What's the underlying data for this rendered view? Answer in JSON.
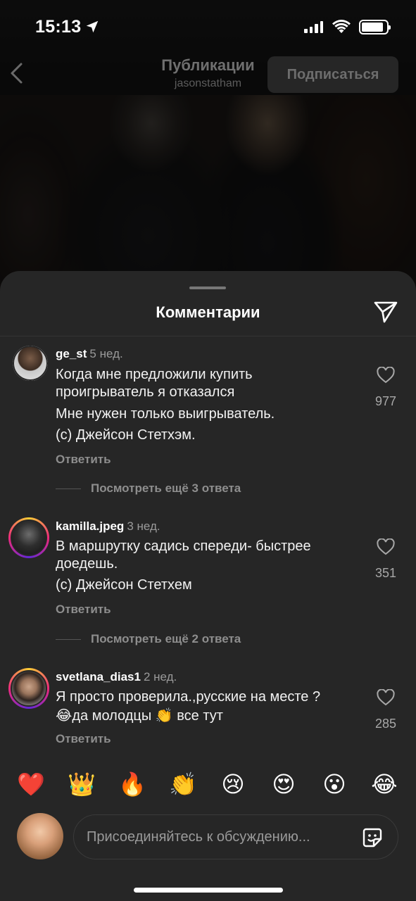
{
  "status_bar": {
    "time": "15:13"
  },
  "nav": {
    "title": "Публикации",
    "subtitle": "jasonstatham",
    "follow_label": "Подписаться"
  },
  "sheet": {
    "title": "Комментарии"
  },
  "comments": [
    {
      "username": "ge_st",
      "ago": "5 нед.",
      "lines": [
        "Когда мне предложили купить",
        "проигрыватель я отказался",
        "Мне нужен только выигрыватель.",
        "(с) Джейсон Стетхэм."
      ],
      "reply": "Ответить",
      "likes": "977",
      "more_replies": "Посмотреть ещё 3 ответа"
    },
    {
      "username": "kamilla.jpeg",
      "ago": "3 нед.",
      "lines": [
        "В маршрутку садись спереди- быстрее",
        "доедешь.",
        "(с) Джейсон Стетхем"
      ],
      "reply": "Ответить",
      "likes": "351",
      "more_replies": "Посмотреть ещё 2 ответа"
    },
    {
      "username": "svetlana_dias1",
      "ago": "2 нед.",
      "lines": [
        "Я просто проверила.,русские на месте ?",
        "😂да молодцы 👏 все тут"
      ],
      "reply": "Ответить",
      "likes": "285"
    }
  ],
  "reactions": [
    "❤️",
    "👑",
    "🔥",
    "👏",
    "😢",
    "😍",
    "😮",
    "😂"
  ],
  "composer": {
    "placeholder": "Присоединяйтесь к обсуждению..."
  },
  "colors": {
    "sheet_bg": "#262626",
    "secondary_text": "#8e8e8e",
    "heart_red": "#ed4956"
  }
}
